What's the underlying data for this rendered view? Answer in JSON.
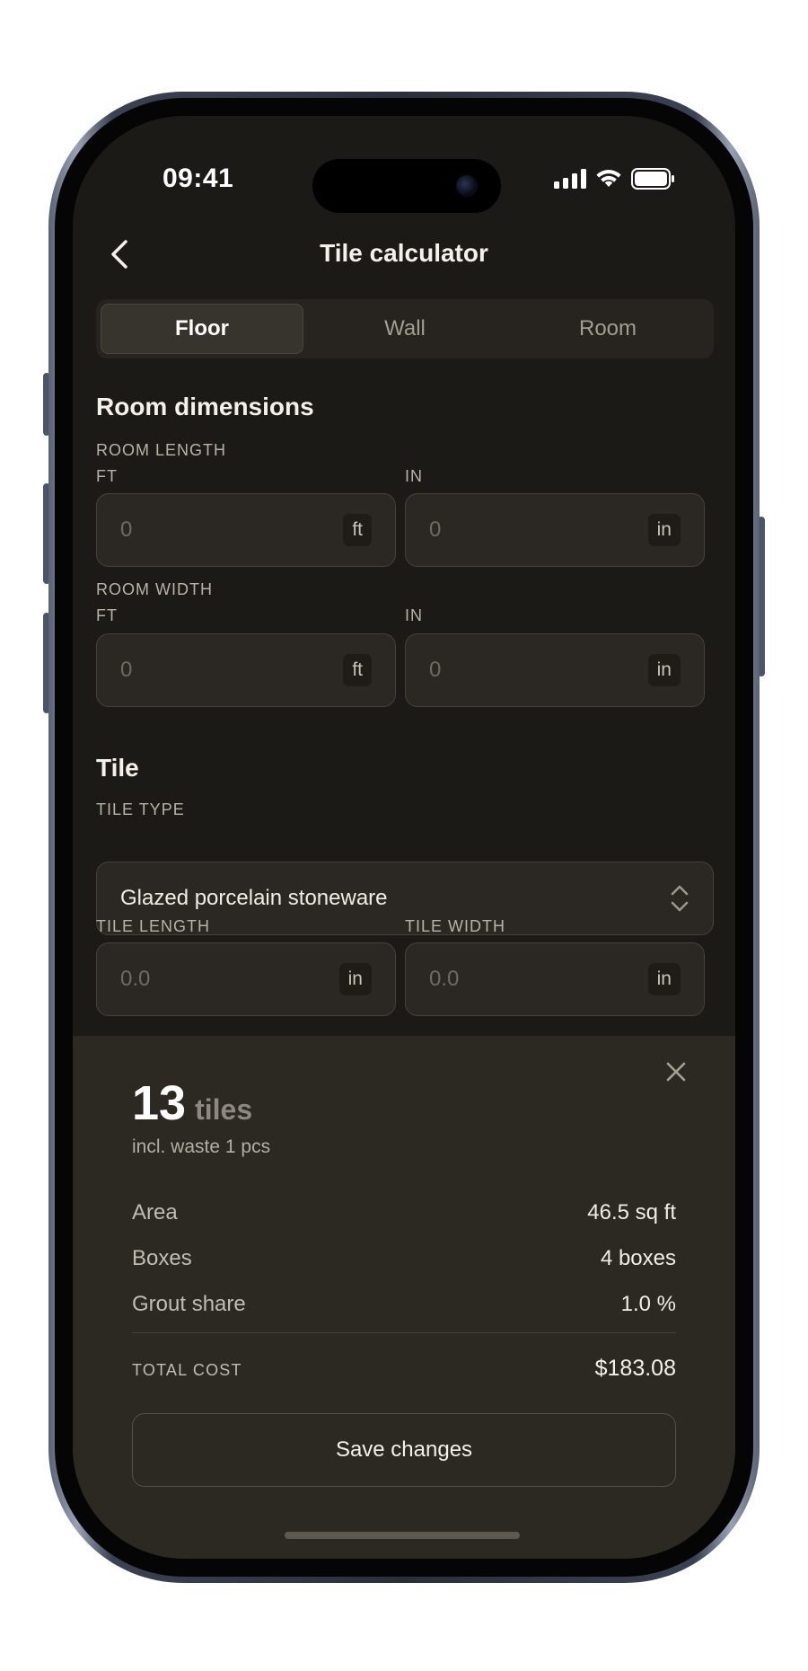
{
  "status": {
    "time": "09:41"
  },
  "nav": {
    "title": "Tile calculator",
    "back_icon": "chevron-left-icon"
  },
  "tabs": [
    {
      "label": "Floor",
      "active": true
    },
    {
      "label": "Wall",
      "active": false
    },
    {
      "label": "Room",
      "active": false
    }
  ],
  "room": {
    "section_title": "Room dimensions",
    "length": {
      "label": "ROOM LENGTH",
      "ft_label": "FT",
      "in_label": "IN",
      "ft_placeholder": "0",
      "ft_unit": "ft",
      "in_placeholder": "0",
      "in_unit": "in"
    },
    "width": {
      "label": "ROOM WIDTH",
      "ft_label": "FT",
      "in_label": "IN",
      "ft_placeholder": "0",
      "ft_unit": "ft",
      "in_placeholder": "0",
      "in_unit": "in"
    }
  },
  "tile": {
    "section_title": "Tile",
    "type_label": "TILE TYPE",
    "type_value": "Glazed porcelain stoneware",
    "length_label": "TILE LENGTH",
    "length_placeholder": "0.0",
    "length_unit": "in",
    "width_label": "TILE WIDTH",
    "width_placeholder": "0.0",
    "width_unit": "in"
  },
  "result": {
    "count": "13",
    "count_unit": "tiles",
    "waste": "incl. waste 1 pcs",
    "rows": [
      {
        "key": "Area",
        "value": "46.5 sq ft"
      },
      {
        "key": "Boxes",
        "value": "4 boxes"
      },
      {
        "key": "Grout share",
        "value": "1.0 %"
      }
    ],
    "total_label": "TOTAL COST",
    "total_value": "$183.08",
    "save_label": "Save changes"
  },
  "colors": {
    "background": "#1c1a17",
    "sheet": "#2c2923",
    "field": "#2b2823",
    "text": "#f4f1ea"
  }
}
